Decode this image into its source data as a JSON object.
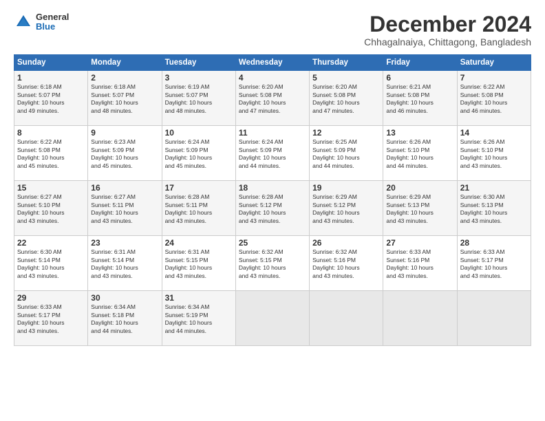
{
  "header": {
    "logo_general": "General",
    "logo_blue": "Blue",
    "title": "December 2024",
    "subtitle": "Chhagalnaiya, Chittagong, Bangladesh"
  },
  "weekdays": [
    "Sunday",
    "Monday",
    "Tuesday",
    "Wednesday",
    "Thursday",
    "Friday",
    "Saturday"
  ],
  "weeks": [
    [
      {
        "day": "1",
        "lines": [
          "Sunrise: 6:18 AM",
          "Sunset: 5:07 PM",
          "Daylight: 10 hours",
          "and 49 minutes."
        ]
      },
      {
        "day": "2",
        "lines": [
          "Sunrise: 6:18 AM",
          "Sunset: 5:07 PM",
          "Daylight: 10 hours",
          "and 48 minutes."
        ]
      },
      {
        "day": "3",
        "lines": [
          "Sunrise: 6:19 AM",
          "Sunset: 5:07 PM",
          "Daylight: 10 hours",
          "and 48 minutes."
        ]
      },
      {
        "day": "4",
        "lines": [
          "Sunrise: 6:20 AM",
          "Sunset: 5:08 PM",
          "Daylight: 10 hours",
          "and 47 minutes."
        ]
      },
      {
        "day": "5",
        "lines": [
          "Sunrise: 6:20 AM",
          "Sunset: 5:08 PM",
          "Daylight: 10 hours",
          "and 47 minutes."
        ]
      },
      {
        "day": "6",
        "lines": [
          "Sunrise: 6:21 AM",
          "Sunset: 5:08 PM",
          "Daylight: 10 hours",
          "and 46 minutes."
        ]
      },
      {
        "day": "7",
        "lines": [
          "Sunrise: 6:22 AM",
          "Sunset: 5:08 PM",
          "Daylight: 10 hours",
          "and 46 minutes."
        ]
      }
    ],
    [
      {
        "day": "8",
        "lines": [
          "Sunrise: 6:22 AM",
          "Sunset: 5:08 PM",
          "Daylight: 10 hours",
          "and 45 minutes."
        ]
      },
      {
        "day": "9",
        "lines": [
          "Sunrise: 6:23 AM",
          "Sunset: 5:09 PM",
          "Daylight: 10 hours",
          "and 45 minutes."
        ]
      },
      {
        "day": "10",
        "lines": [
          "Sunrise: 6:24 AM",
          "Sunset: 5:09 PM",
          "Daylight: 10 hours",
          "and 45 minutes."
        ]
      },
      {
        "day": "11",
        "lines": [
          "Sunrise: 6:24 AM",
          "Sunset: 5:09 PM",
          "Daylight: 10 hours",
          "and 44 minutes."
        ]
      },
      {
        "day": "12",
        "lines": [
          "Sunrise: 6:25 AM",
          "Sunset: 5:09 PM",
          "Daylight: 10 hours",
          "and 44 minutes."
        ]
      },
      {
        "day": "13",
        "lines": [
          "Sunrise: 6:26 AM",
          "Sunset: 5:10 PM",
          "Daylight: 10 hours",
          "and 44 minutes."
        ]
      },
      {
        "day": "14",
        "lines": [
          "Sunrise: 6:26 AM",
          "Sunset: 5:10 PM",
          "Daylight: 10 hours",
          "and 43 minutes."
        ]
      }
    ],
    [
      {
        "day": "15",
        "lines": [
          "Sunrise: 6:27 AM",
          "Sunset: 5:10 PM",
          "Daylight: 10 hours",
          "and 43 minutes."
        ]
      },
      {
        "day": "16",
        "lines": [
          "Sunrise: 6:27 AM",
          "Sunset: 5:11 PM",
          "Daylight: 10 hours",
          "and 43 minutes."
        ]
      },
      {
        "day": "17",
        "lines": [
          "Sunrise: 6:28 AM",
          "Sunset: 5:11 PM",
          "Daylight: 10 hours",
          "and 43 minutes."
        ]
      },
      {
        "day": "18",
        "lines": [
          "Sunrise: 6:28 AM",
          "Sunset: 5:12 PM",
          "Daylight: 10 hours",
          "and 43 minutes."
        ]
      },
      {
        "day": "19",
        "lines": [
          "Sunrise: 6:29 AM",
          "Sunset: 5:12 PM",
          "Daylight: 10 hours",
          "and 43 minutes."
        ]
      },
      {
        "day": "20",
        "lines": [
          "Sunrise: 6:29 AM",
          "Sunset: 5:13 PM",
          "Daylight: 10 hours",
          "and 43 minutes."
        ]
      },
      {
        "day": "21",
        "lines": [
          "Sunrise: 6:30 AM",
          "Sunset: 5:13 PM",
          "Daylight: 10 hours",
          "and 43 minutes."
        ]
      }
    ],
    [
      {
        "day": "22",
        "lines": [
          "Sunrise: 6:30 AM",
          "Sunset: 5:14 PM",
          "Daylight: 10 hours",
          "and 43 minutes."
        ]
      },
      {
        "day": "23",
        "lines": [
          "Sunrise: 6:31 AM",
          "Sunset: 5:14 PM",
          "Daylight: 10 hours",
          "and 43 minutes."
        ]
      },
      {
        "day": "24",
        "lines": [
          "Sunrise: 6:31 AM",
          "Sunset: 5:15 PM",
          "Daylight: 10 hours",
          "and 43 minutes."
        ]
      },
      {
        "day": "25",
        "lines": [
          "Sunrise: 6:32 AM",
          "Sunset: 5:15 PM",
          "Daylight: 10 hours",
          "and 43 minutes."
        ]
      },
      {
        "day": "26",
        "lines": [
          "Sunrise: 6:32 AM",
          "Sunset: 5:16 PM",
          "Daylight: 10 hours",
          "and 43 minutes."
        ]
      },
      {
        "day": "27",
        "lines": [
          "Sunrise: 6:33 AM",
          "Sunset: 5:16 PM",
          "Daylight: 10 hours",
          "and 43 minutes."
        ]
      },
      {
        "day": "28",
        "lines": [
          "Sunrise: 6:33 AM",
          "Sunset: 5:17 PM",
          "Daylight: 10 hours",
          "and 43 minutes."
        ]
      }
    ],
    [
      {
        "day": "29",
        "lines": [
          "Sunrise: 6:33 AM",
          "Sunset: 5:17 PM",
          "Daylight: 10 hours",
          "and 43 minutes."
        ]
      },
      {
        "day": "30",
        "lines": [
          "Sunrise: 6:34 AM",
          "Sunset: 5:18 PM",
          "Daylight: 10 hours",
          "and 44 minutes."
        ]
      },
      {
        "day": "31",
        "lines": [
          "Sunrise: 6:34 AM",
          "Sunset: 5:19 PM",
          "Daylight: 10 hours",
          "and 44 minutes."
        ]
      },
      {
        "day": "",
        "lines": []
      },
      {
        "day": "",
        "lines": []
      },
      {
        "day": "",
        "lines": []
      },
      {
        "day": "",
        "lines": []
      }
    ]
  ]
}
